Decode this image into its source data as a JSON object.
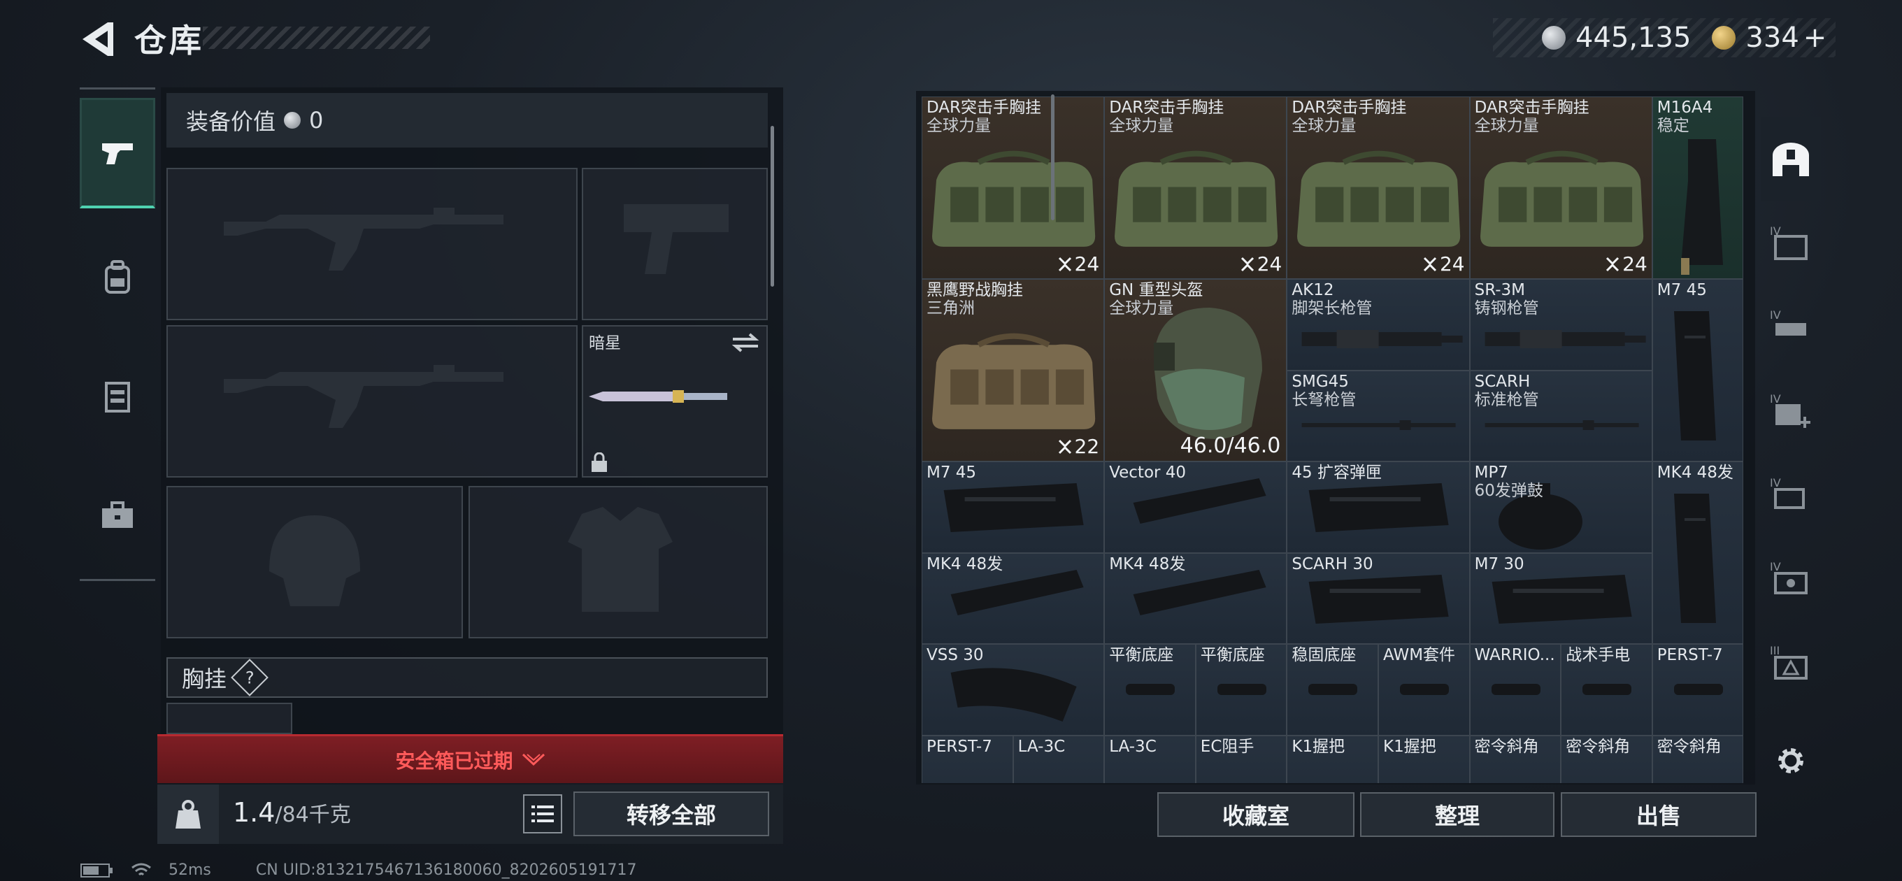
{
  "header": {
    "title": "仓库"
  },
  "currency": {
    "silver": "445,135",
    "gold": "334",
    "gold_plus": "+"
  },
  "left_categories": [
    "gun-icon",
    "backpack-icon",
    "vest-icon",
    "briefcase-icon"
  ],
  "loadout": {
    "equip_value_label": "装备价值",
    "equip_value": "0",
    "melee_name": "暗星",
    "chest_label": "胸挂",
    "chest_help": "?",
    "safe_box_expired": "安全箱已过期",
    "weight_value": "1.4",
    "weight_cap": "/84千克",
    "transfer_all": "转移全部"
  },
  "storage": {
    "rows": [
      [
        {
          "n1": "DAR突击手胸挂",
          "n2": "全球力量",
          "count": "24",
          "color": "brown",
          "art": "bag"
        },
        {
          "n1": "DAR突击手胸挂",
          "n2": "全球力量",
          "count": "24",
          "color": "brown",
          "art": "bag"
        },
        {
          "n1": "DAR突击手胸挂",
          "n2": "全球力量",
          "count": "24",
          "color": "brown",
          "art": "bag"
        },
        {
          "n1": "DAR突击手胸挂",
          "n2": "全球力量",
          "count": "24",
          "color": "brown",
          "art": "bag"
        },
        {
          "n1": "M16A4",
          "n2": "稳定",
          "color": "green",
          "art": "stock"
        }
      ],
      [
        {
          "n1": "黑鹰野战胸挂",
          "n2": "三角洲",
          "count": "22",
          "color": "brown",
          "art": "bag2"
        },
        {
          "n1": "GN 重型头盔",
          "n2": "全球力量",
          "durability": "46.0/46.0",
          "color": "brown",
          "art": "helmet"
        },
        {
          "n1": "AK12",
          "n2": "脚架长枪管",
          "color": "blue",
          "art": "barrel"
        },
        {
          "n1": "SR-3M",
          "n2": "铸钢枪管",
          "color": "blue",
          "art": "barrel2"
        },
        {
          "n1": "M7 45",
          "color": "blue",
          "art": "mag-tall"
        },
        {
          "n1": "SMG45",
          "n2": "长弩枪管",
          "color": "blue",
          "art": "rod"
        },
        {
          "n1": "SCARH",
          "n2": "标准枪管",
          "color": "blue",
          "art": "rod"
        }
      ],
      [
        {
          "n1": "M7 45",
          "color": "blue",
          "art": "mag"
        },
        {
          "n1": "Vector 40",
          "color": "blue",
          "art": "mag-angled"
        },
        {
          "n1": "45 扩容弹匣",
          "color": "blue",
          "art": "mag"
        },
        {
          "n1": "MP7",
          "n2": "60发弹鼓",
          "color": "blue",
          "art": "drum"
        },
        {
          "n1": "MK4 48发",
          "color": "blue",
          "art": "mag-tall"
        },
        {
          "n1": "MK4 48发",
          "color": "blue",
          "art": "mag-angled"
        },
        {
          "n1": "MK4 48发",
          "color": "blue",
          "art": "mag-angled"
        },
        {
          "n1": "SCARH 30",
          "color": "blue",
          "art": "mag"
        },
        {
          "n1": "M7 30",
          "color": "blue",
          "art": "mag"
        }
      ],
      [
        {
          "n1": "VSS 30",
          "color": "blue",
          "art": "mag-curve"
        },
        {
          "n1": "平衡底座",
          "color": "blue",
          "art": "small"
        },
        {
          "n1": "平衡底座",
          "color": "blue",
          "art": "small"
        },
        {
          "n1": "稳固底座",
          "color": "blue",
          "art": "small"
        },
        {
          "n1": "AWM套件",
          "color": "blue",
          "art": "small"
        },
        {
          "n1": "WARRIO...",
          "color": "blue",
          "art": "small"
        },
        {
          "n1": "战术手电",
          "color": "blue",
          "art": "small"
        },
        {
          "n1": "PERST-7",
          "color": "blue",
          "art": "small"
        }
      ],
      [
        {
          "n1": "PERST-7",
          "color": "blue"
        },
        {
          "n1": "LA-3C",
          "color": "blue"
        },
        {
          "n1": "LA-3C",
          "color": "blue"
        },
        {
          "n1": "EC阻手",
          "color": "blue"
        },
        {
          "n1": "K1握把",
          "color": "blue"
        },
        {
          "n1": "K1握把",
          "color": "blue"
        },
        {
          "n1": "密令斜角",
          "color": "blue"
        },
        {
          "n1": "密令斜角",
          "color": "blue"
        },
        {
          "n1": "密令斜角",
          "color": "blue"
        }
      ]
    ],
    "buttons": {
      "collection": "收藏室",
      "organize": "整理",
      "sell": "出售"
    }
  },
  "status_bar": {
    "ping": "52ms",
    "uid": "CN UID:8132175467136180060_8202605191717"
  },
  "colors": {
    "accent_teal": "#4fd1b0",
    "alert_red": "#ff5a5a"
  }
}
